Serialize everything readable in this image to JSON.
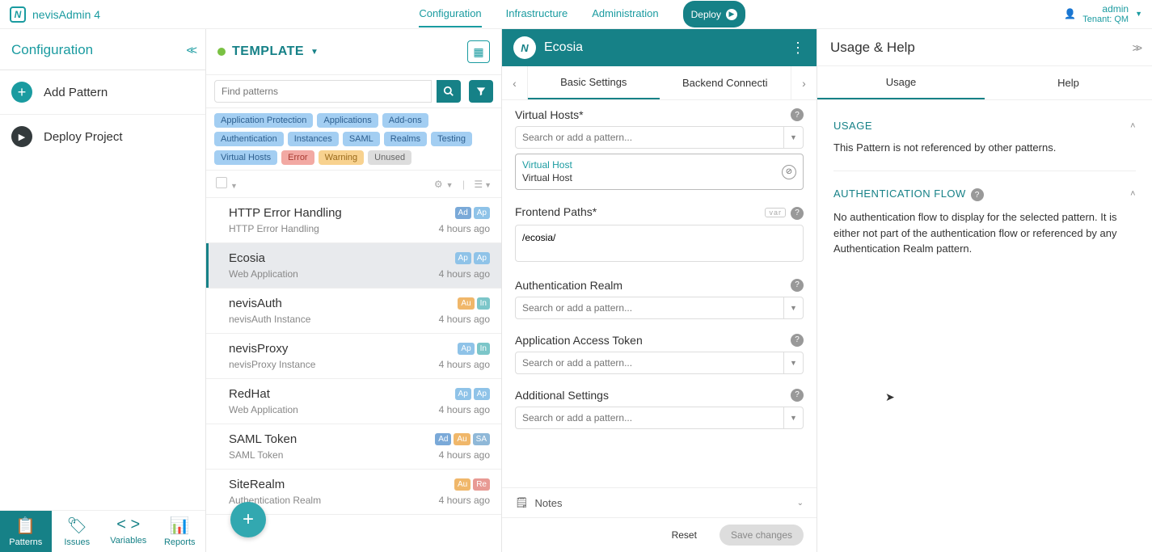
{
  "topbar": {
    "brand": "nevisAdmin 4",
    "nav": {
      "configuration": "Configuration",
      "infrastructure": "Infrastructure",
      "administration": "Administration"
    },
    "deploy_label": "Deploy",
    "user": {
      "name": "admin",
      "tenant": "Tenant: QM"
    }
  },
  "leftnav": {
    "title": "Configuration",
    "add_pattern": "Add Pattern",
    "deploy_project": "Deploy Project",
    "tabs": {
      "patterns": "Patterns",
      "issues": "Issues",
      "variables": "Variables",
      "reports": "Reports"
    }
  },
  "mid": {
    "project_title": "TEMPLATE",
    "search_placeholder": "Find patterns",
    "tags": [
      {
        "label": "Application Protection",
        "cls": "blue"
      },
      {
        "label": "Applications",
        "cls": "blue"
      },
      {
        "label": "Add-ons",
        "cls": "blue"
      },
      {
        "label": "Authentication",
        "cls": "blue"
      },
      {
        "label": "Instances",
        "cls": "blue"
      },
      {
        "label": "SAML",
        "cls": "blue"
      },
      {
        "label": "Realms",
        "cls": "blue"
      },
      {
        "label": "Testing",
        "cls": "blue"
      },
      {
        "label": "Virtual Hosts",
        "cls": "blue"
      },
      {
        "label": "Error",
        "cls": "red"
      },
      {
        "label": "Warning",
        "cls": "orange"
      },
      {
        "label": "Unused",
        "cls": "grey"
      }
    ],
    "items": [
      {
        "name": "HTTP Error Handling",
        "sub": "HTTP Error Handling",
        "time": "4 hours ago",
        "badges": [
          "Ad",
          "Ap"
        ]
      },
      {
        "name": "Ecosia",
        "sub": "Web Application",
        "time": "4 hours ago",
        "badges": [
          "Ap",
          "Ap"
        ],
        "selected": true
      },
      {
        "name": "nevisAuth",
        "sub": "nevisAuth Instance",
        "time": "4 hours ago",
        "badges": [
          "Au",
          "In"
        ]
      },
      {
        "name": "nevisProxy",
        "sub": "nevisProxy Instance",
        "time": "4 hours ago",
        "badges": [
          "Ap",
          "In"
        ]
      },
      {
        "name": "RedHat",
        "sub": "Web Application",
        "time": "4 hours ago",
        "badges": [
          "Ap",
          "Ap"
        ]
      },
      {
        "name": "SAML Token",
        "sub": "SAML Token",
        "time": "4 hours ago",
        "badges": [
          "Ad",
          "Au",
          "SA"
        ]
      },
      {
        "name": "SiteRealm",
        "sub": "Authentication Realm",
        "time": "4 hours ago",
        "badges": [
          "Au",
          "Re"
        ]
      }
    ]
  },
  "detail": {
    "title": "Ecosia",
    "tabs": {
      "basic": "Basic Settings",
      "backend": "Backend Connecti"
    },
    "fields": {
      "vhosts_label": "Virtual Hosts*",
      "search_pattern_ph": "Search or add a pattern...",
      "vhost_type": "Virtual Host",
      "vhost_val": "Virtual Host",
      "frontend_label": "Frontend Paths*",
      "frontend_val": "/ecosia/",
      "var_badge": "var",
      "authrealm_label": "Authentication Realm",
      "token_label": "Application Access Token",
      "addl_label": "Additional Settings"
    },
    "notes_label": "Notes",
    "reset": "Reset",
    "save": "Save changes"
  },
  "right": {
    "title": "Usage & Help",
    "tabs": {
      "usage": "Usage",
      "help": "Help"
    },
    "usage": {
      "title": "USAGE",
      "text": "This Pattern is not referenced by other patterns."
    },
    "authflow": {
      "title": "AUTHENTICATION FLOW",
      "text": "No authentication flow to display for the selected pattern. It is either not part of the authentication flow or referenced by any Authentication Realm pattern."
    }
  }
}
